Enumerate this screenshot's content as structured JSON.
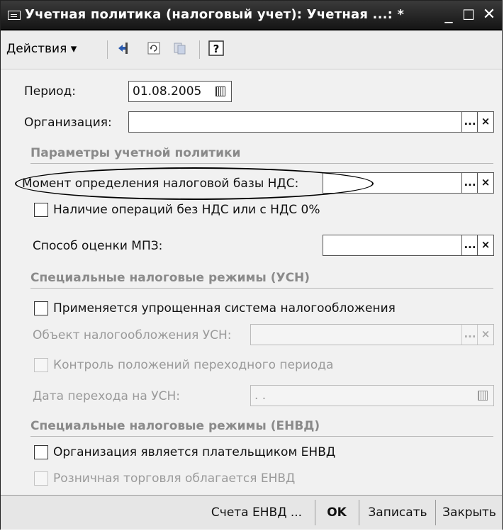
{
  "window": {
    "title": "Учетная политика (налоговый учет): Учетная ...: *",
    "buttons": {
      "minimize": "_",
      "maximize": "☐",
      "close": "✕"
    }
  },
  "toolbar": {
    "actions_label": "Действия ▾",
    "icons": [
      "go-to-icon",
      "refresh-icon",
      "document-icon",
      "help-icon"
    ],
    "help_glyph": "?"
  },
  "form": {
    "period": {
      "label": "Период:",
      "value": "01.08.2005"
    },
    "organization": {
      "label": "Организация:",
      "value": ""
    },
    "section_policy": "Параметры учетной политики",
    "vat_base_moment": {
      "label": "Момент определения налоговой базы НДС:",
      "value": ""
    },
    "no_vat_operations": {
      "label": "Наличие операций без НДС или с НДС 0%",
      "checked": false
    },
    "mpz_valuation": {
      "label": "Способ оценки МПЗ:",
      "value": ""
    },
    "section_usn": "Специальные налоговые режимы (УСН)",
    "usn_applied": {
      "label": "Применяется упрощенная система налогообложения",
      "checked": false
    },
    "usn_object": {
      "label": "Объект налогообложения УСН:",
      "value": "",
      "disabled": true
    },
    "transition_control": {
      "label": "Контроль положений переходного периода",
      "checked": false,
      "disabled": true
    },
    "usn_transition_date": {
      "label": "Дата перехода на УСН:",
      "value": " .  .",
      "disabled": true
    },
    "section_envd": "Специальные налоговые режимы (ЕНВД)",
    "envd_payer": {
      "label": "Организация является плательщиком ЕНВД",
      "checked": false
    },
    "retail_envd": {
      "label": "Розничная торговля облагается ЕНВД",
      "checked": false,
      "disabled": true
    }
  },
  "field_buttons": {
    "select": "...",
    "clear": "×"
  },
  "bottom_bar": {
    "envd_accounts": "Счета ЕНВД ...",
    "ok": "OK",
    "save": "Записать",
    "close": "Закрыть"
  }
}
